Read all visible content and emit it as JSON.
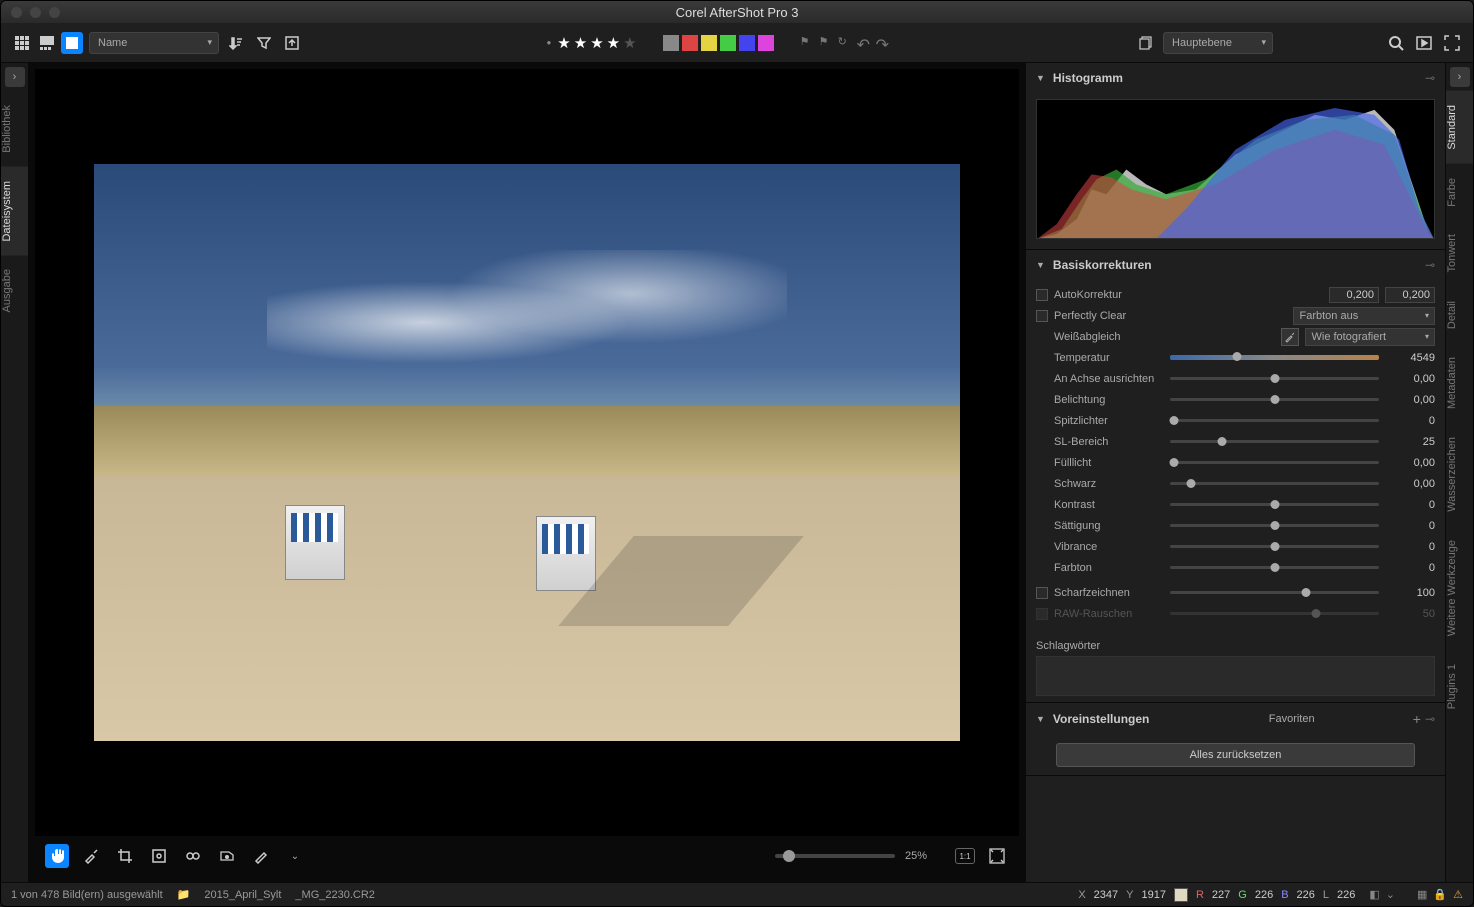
{
  "app": {
    "title": "Corel AfterShot Pro 3"
  },
  "toolbar": {
    "sort_dropdown": "Name",
    "layer_dropdown": "Hauptebene",
    "stars": 4,
    "colors": [
      "#888888",
      "#d44444",
      "#e4d444",
      "#44c444",
      "#4444e4",
      "#d444d4"
    ]
  },
  "left_tabs": [
    "Bibliothek",
    "Dateisystem",
    "Ausgabe"
  ],
  "right_tabs": [
    "Standard",
    "Farbe",
    "Tonwert",
    "Detail",
    "Metadaten",
    "Wasserzeichen",
    "Weitere Werkzeuge",
    "Plugins 1"
  ],
  "panels": {
    "histogram": {
      "title": "Histogramm"
    },
    "basic": {
      "title": "Basiskorrekturen",
      "auto_label": "AutoKorrektur",
      "auto_v1": "0,200",
      "auto_v2": "0,200",
      "perfectly_clear": "Perfectly Clear",
      "pc_dropdown": "Farbton aus",
      "wb_label": "Weißabgleich",
      "wb_dropdown": "Wie fotografiert",
      "sliders": [
        {
          "label": "Temperatur",
          "value": "4549",
          "pos": 32
        },
        {
          "label": "An Achse ausrichten",
          "value": "0,00",
          "pos": 50
        },
        {
          "label": "Belichtung",
          "value": "0,00",
          "pos": 50
        },
        {
          "label": "Spitzlichter",
          "value": "0",
          "pos": 2
        },
        {
          "label": "SL-Bereich",
          "value": "25",
          "pos": 25
        },
        {
          "label": "Fülllicht",
          "value": "0,00",
          "pos": 2
        },
        {
          "label": "Schwarz",
          "value": "0,00",
          "pos": 10
        },
        {
          "label": "Kontrast",
          "value": "0",
          "pos": 50
        },
        {
          "label": "Sättigung",
          "value": "0",
          "pos": 50
        },
        {
          "label": "Vibrance",
          "value": "0",
          "pos": 50
        },
        {
          "label": "Farbton",
          "value": "0",
          "pos": 50
        }
      ],
      "sharpen_label": "Scharfzeichnen",
      "sharpen_value": "100",
      "raw_noise_label": "RAW-Rauschen",
      "raw_noise_value": "50",
      "keywords_label": "Schlagwörter"
    },
    "presets": {
      "title": "Voreinstellungen",
      "dropdown": "Favoriten"
    },
    "reset_button": "Alles zurücksetzen"
  },
  "viewer": {
    "zoom": "25%"
  },
  "status": {
    "selection": "1 von 478 Bild(ern) ausgewählt",
    "folder": "2015_April_Sylt",
    "filename": "_MG_2230.CR2",
    "coords_x_label": "X",
    "coords_x": "2347",
    "coords_y_label": "Y",
    "coords_y": "1917",
    "r_label": "R",
    "r": "227",
    "g_label": "G",
    "g": "226",
    "b_label": "B",
    "b": "226",
    "l_label": "L",
    "l": "226"
  }
}
